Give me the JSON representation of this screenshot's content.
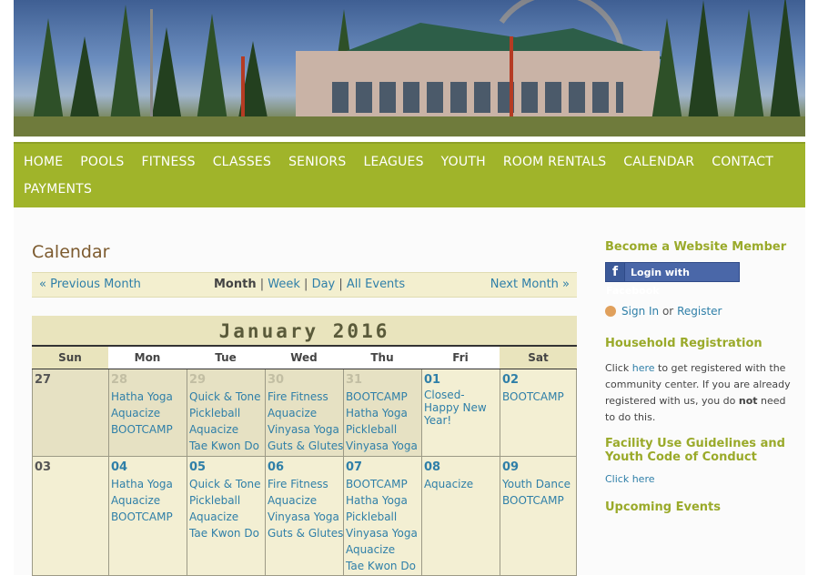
{
  "nav": {
    "row1": [
      "HOME",
      "POOLS",
      "FITNESS",
      "CLASSES",
      "SENIORS",
      "LEAGUES",
      "YOUTH",
      "ROOM RENTALS",
      "CALENDAR",
      "CONTACT"
    ],
    "row2": [
      "PAYMENTS"
    ]
  },
  "page": {
    "title": "Calendar"
  },
  "month_nav": {
    "prev": "« Previous Month",
    "next": "Next Month »",
    "views": {
      "month": "Month",
      "week": "Week",
      "day": "Day",
      "all": "All Events",
      "sep": "|"
    }
  },
  "calendar": {
    "title": "January 2016",
    "days_of_week": [
      "Sun",
      "Mon",
      "Tue",
      "Wed",
      "Thu",
      "Fri",
      "Sat"
    ],
    "weeks": [
      [
        {
          "day": "27",
          "other": true,
          "events": []
        },
        {
          "day": "28",
          "other": true,
          "events": [
            "Hatha Yoga",
            "Aquacize",
            "BOOTCAMP"
          ]
        },
        {
          "day": "29",
          "other": true,
          "events": [
            "Quick & Tone",
            "Pickleball",
            "Aquacize",
            "Tae Kwon Do"
          ]
        },
        {
          "day": "30",
          "other": true,
          "events": [
            "Fire Fitness",
            "Aquacize",
            "Vinyasa Yoga",
            "Guts & Glutes"
          ]
        },
        {
          "day": "31",
          "other": true,
          "events": [
            "BOOTCAMP",
            "Hatha Yoga",
            "Pickleball",
            "Vinyasa Yoga"
          ]
        },
        {
          "day": "01",
          "other": false,
          "events": [
            "Closed-Happy New Year!"
          ]
        },
        {
          "day": "02",
          "other": false,
          "events": [
            "BOOTCAMP"
          ]
        }
      ],
      [
        {
          "day": "03",
          "other": false,
          "events": []
        },
        {
          "day": "04",
          "other": false,
          "events": [
            "Hatha Yoga",
            "Aquacize",
            "BOOTCAMP"
          ]
        },
        {
          "day": "05",
          "other": false,
          "events": [
            "Quick & Tone",
            "Pickleball",
            "Aquacize",
            "Tae Kwon Do"
          ]
        },
        {
          "day": "06",
          "other": false,
          "events": [
            "Fire Fitness",
            "Aquacize",
            "Vinyasa Yoga",
            "Guts & Glutes"
          ]
        },
        {
          "day": "07",
          "other": false,
          "events": [
            "BOOTCAMP",
            "Hatha Yoga",
            "Pickleball",
            "Vinyasa Yoga",
            "Aquacize",
            "Tae Kwon Do"
          ]
        },
        {
          "day": "08",
          "other": false,
          "events": [
            "Aquacize"
          ]
        },
        {
          "day": "09",
          "other": false,
          "events": [
            "Youth Dance",
            "BOOTCAMP"
          ]
        }
      ]
    ]
  },
  "sidebar": {
    "member_title": "Become a Website Member",
    "facebook_label": "Login with Facebook",
    "facebook_glyph": "f",
    "sign_in": "Sign In",
    "or": "or",
    "register": "Register",
    "household_title": "Household Registration",
    "household_text_1": "Click",
    "household_here": "here",
    "household_text_2": "to get registered with the community center. If you are already registered with us, you do",
    "household_not": "not",
    "household_text_3": "need to do this.",
    "facility_title": "Facility Use Guidelines and Youth Code of Conduct",
    "facility_link": "Click here",
    "upcoming_title": "Upcoming Events"
  },
  "colors": {
    "nav_bg": "#a0b42a",
    "accent_green": "#9aaa2a",
    "link_blue": "#2f7fa8",
    "title_brown": "#7c5a2e",
    "calendar_cell": "#f3efd3"
  }
}
